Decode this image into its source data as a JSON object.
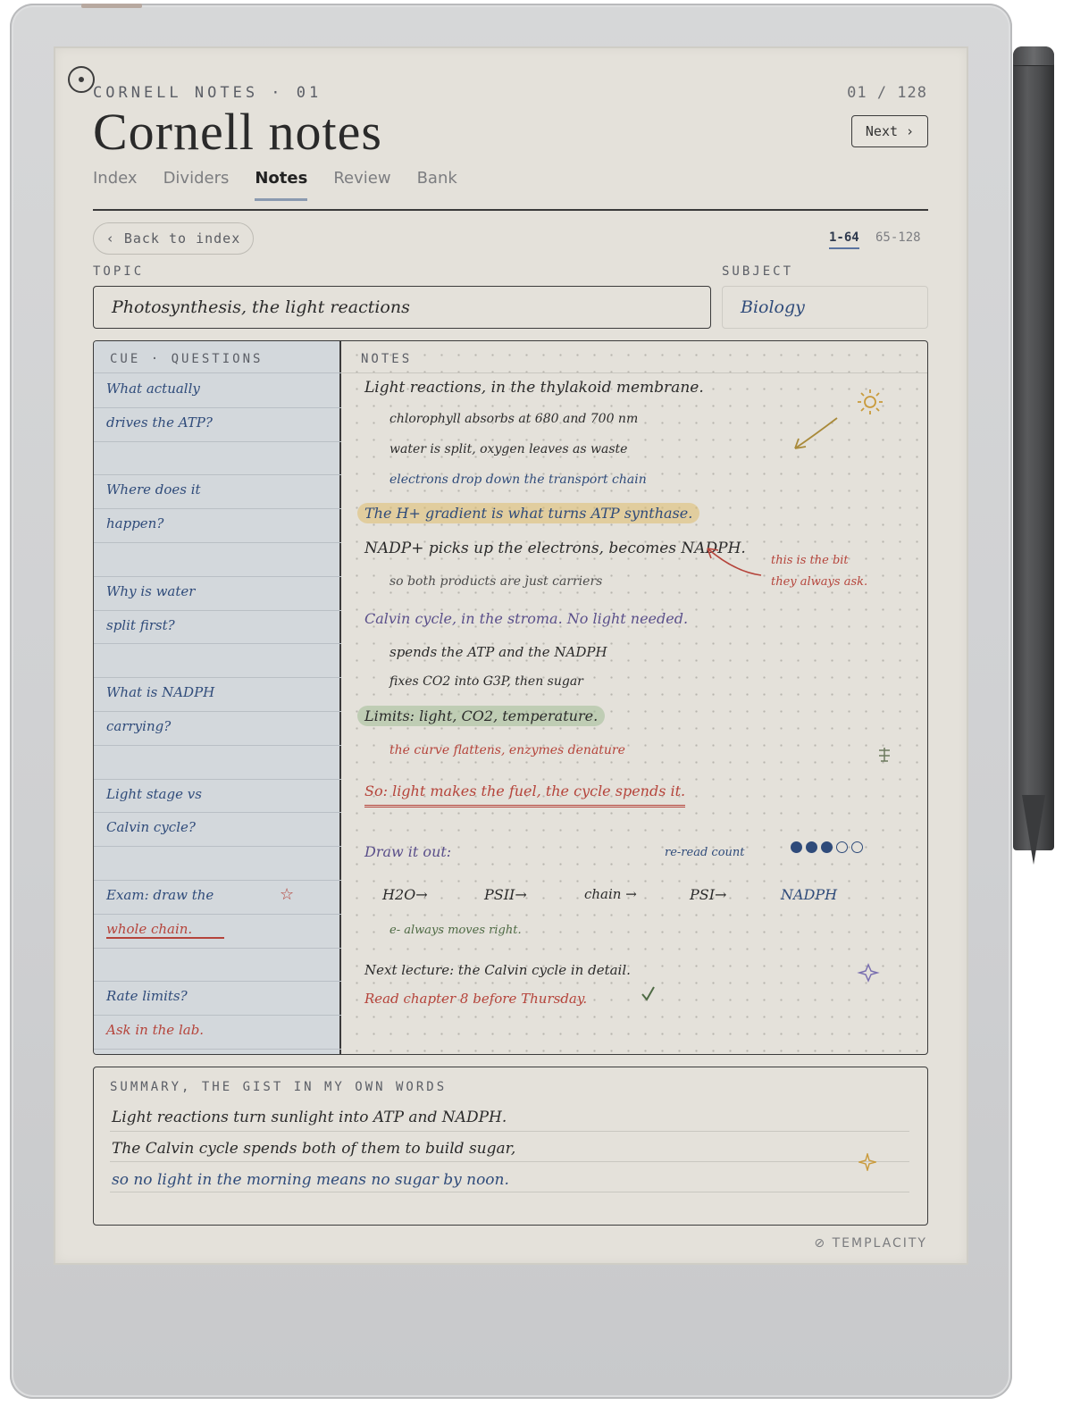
{
  "header": {
    "kicker": "CORNELL NOTES · 01",
    "page_counter": "01 / 128",
    "title": "Cornell notes",
    "next_button": "Next ›"
  },
  "tabs": [
    {
      "label": "Index"
    },
    {
      "label": "Dividers"
    },
    {
      "label": "Notes",
      "active": true
    },
    {
      "label": "Review"
    },
    {
      "label": "Bank"
    }
  ],
  "nav": {
    "back_button": "‹ Back to index",
    "ranges": [
      "1-64",
      "65-128"
    ],
    "active_range": "1-64"
  },
  "fields": {
    "topic_label": "TOPIC",
    "topic_value": "Photosynthesis, the light reactions",
    "subject_label": "SUBJECT",
    "subject_value": "Biology"
  },
  "cue": {
    "heading": "CUE · QUESTIONS",
    "lines": [
      "What actually",
      "drives the ATP?",
      "",
      "Where does it",
      "happen?",
      "",
      "Why is water",
      "split first?",
      "",
      "What is NADPH",
      "carrying?",
      "",
      "Light stage vs",
      "Calvin cycle?",
      "",
      "Exam: draw the",
      "whole chain.",
      "",
      "Rate limits?",
      "Ask in the lab."
    ]
  },
  "notes": {
    "heading": "NOTES",
    "lines": {
      "l1": "Light reactions, in the thylakoid membrane.",
      "l2": "chlorophyll absorbs at 680 and 700 nm",
      "l3": "water is split, oxygen leaves as waste",
      "l4": "electrons drop down the transport chain",
      "l5": "The H+ gradient is what turns ATP synthase.",
      "l6": "NADP+ picks up the electrons, becomes NADPH.",
      "l7": "so both products are just carriers",
      "l8": "Calvin cycle, in the stroma. No light needed.",
      "l9": "spends the ATP and the NADPH",
      "l10": "fixes CO2 into G3P, then sugar",
      "l11": "Limits: light, CO2, temperature.",
      "l12": "the curve flattens, enzymes denature",
      "l13": "So: light makes the fuel, the cycle spends it.",
      "draw": "Draw it out:",
      "reread": "re-read count",
      "reread_count": 3,
      "reread_total": 5,
      "chain": [
        "H2O→",
        "PSII→",
        "chain →",
        "PSI→",
        "NADPH"
      ],
      "moves": "e- always moves right.",
      "next_lecture": "Next lecture: the Calvin cycle in detail.",
      "read_chapter": "Read chapter 8 before Thursday.",
      "margin_note_1": "this is the bit",
      "margin_note_2": "they always ask."
    }
  },
  "summary": {
    "heading": "SUMMARY, THE GIST IN MY OWN WORDS",
    "lines": [
      "Light reactions turn sunlight into ATP and NADPH.",
      "The Calvin cycle spends both of them to build sugar,",
      "so no light in the morning means no sugar by noon."
    ]
  },
  "brand": "TEMPLACITY",
  "colors": {
    "ink": "#2b2b2b",
    "blue_ink": "#2f4b7a",
    "red_ink": "#b5443b",
    "purple_ink": "#5a4f8a",
    "green_ink": "#4f6b45",
    "highlight_yellow": "#dfbe6e",
    "highlight_green": "#a0be96"
  }
}
